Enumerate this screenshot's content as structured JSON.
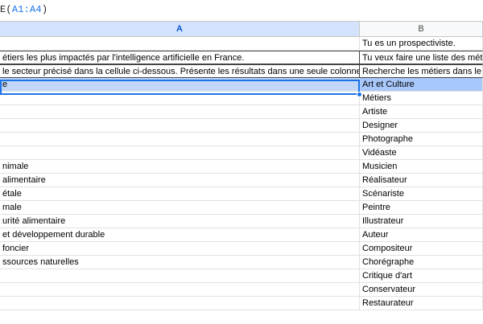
{
  "formula": {
    "fn": "E(",
    "ref": "A1:A4",
    "close": ")"
  },
  "columns": {
    "a": "A",
    "b": "B"
  },
  "rows": [
    {
      "a": "",
      "b": "Tu es un prospectiviste."
    },
    {
      "a": "étiers les plus impactés par l'intelligence artificielle en France.",
      "b": "Tu veux faire une liste des métiers"
    },
    {
      "a": "le secteur précisé dans la cellule ci-dessous. Présente les résultats dans une seule colonne",
      "b": "Recherche les métiers dans le sect"
    },
    {
      "a": "e",
      "b": "Art et Culture"
    },
    {
      "a": "",
      "b": "Métiers"
    },
    {
      "a": "",
      "b": "Artiste"
    },
    {
      "a": "",
      "b": "Designer"
    },
    {
      "a": "",
      "b": "Photographe"
    },
    {
      "a": "",
      "b": "Vidéaste"
    },
    {
      "a": "nimale",
      "b": "Musicien"
    },
    {
      "a": " alimentaire",
      "b": "Réalisateur"
    },
    {
      "a": "étale",
      "b": "Scénariste"
    },
    {
      "a": "male",
      "b": "Peintre"
    },
    {
      "a": "urité alimentaire",
      "b": "Illustrateur"
    },
    {
      "a": " et développement durable",
      "b": "Auteur"
    },
    {
      "a": " foncier",
      "b": "Compositeur"
    },
    {
      "a": "ssources naturelles",
      "b": "Chorégraphe"
    },
    {
      "a": "",
      "b": "Critique d'art"
    },
    {
      "a": "",
      "b": "Conservateur"
    },
    {
      "a": "",
      "b": "Restaurateur"
    }
  ]
}
